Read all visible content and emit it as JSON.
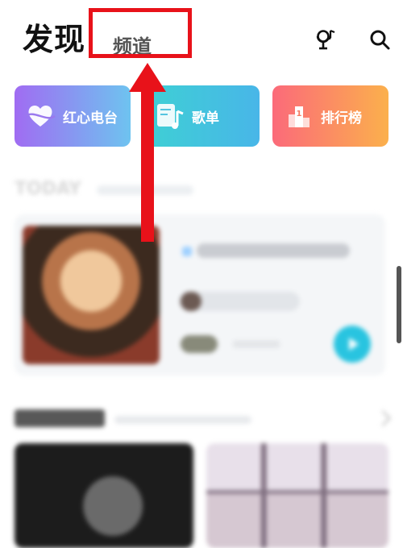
{
  "header": {
    "title": "发现",
    "tab_channel": "频道",
    "icons": [
      "mic-music-icon",
      "search-icon"
    ]
  },
  "entries": [
    {
      "label": "红心电台",
      "icon": "heart-radio-icon"
    },
    {
      "label": "歌单",
      "icon": "playlist-icon"
    },
    {
      "label": "排行榜",
      "icon": "ranking-icon"
    }
  ],
  "colors": {
    "annotation": "#e8121a",
    "radio_gradient": [
      "#a06cf2",
      "#6ec3f0"
    ],
    "playlist_gradient": [
      "#3ed0d4",
      "#48b6e8"
    ],
    "rank_gradient": [
      "#fb6a7a",
      "#fbb04c"
    ],
    "play_button": "#28c4e0"
  }
}
